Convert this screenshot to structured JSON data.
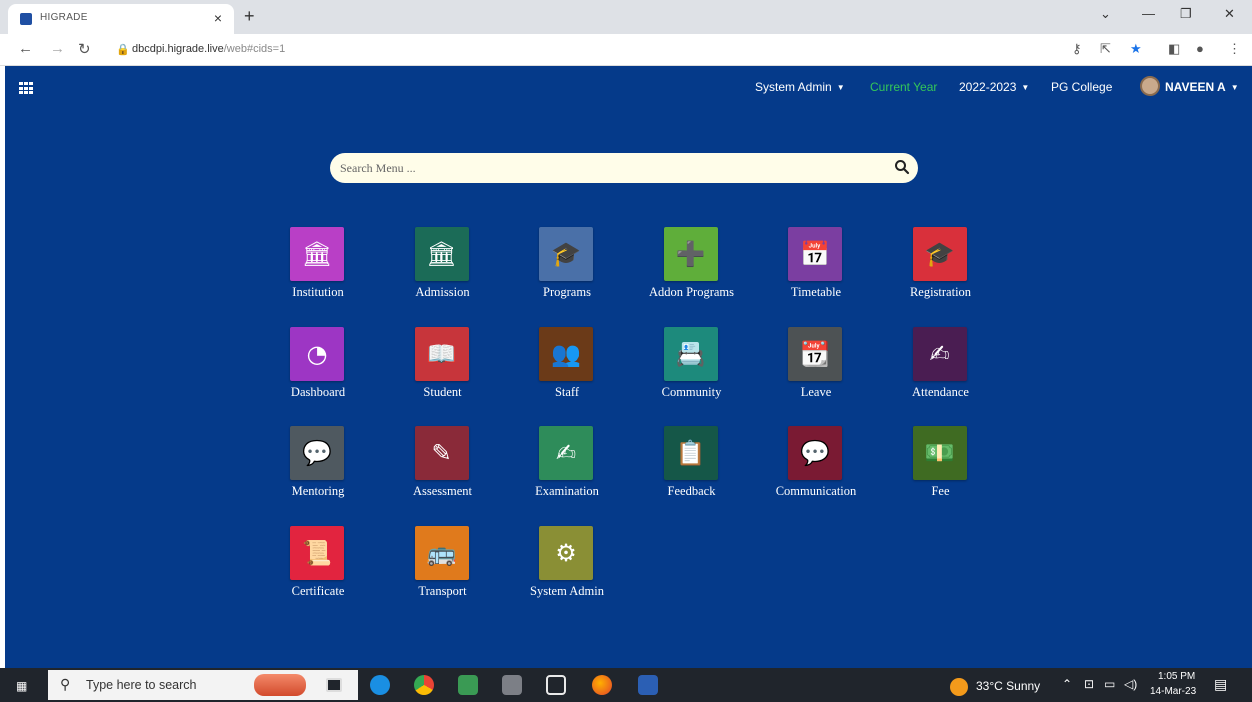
{
  "browser": {
    "tab_title": "HIGRADE",
    "tab_close": "×",
    "new_tab": "+",
    "url_host": "dbcdpi.higrade.live",
    "url_path": "/web#cids=1"
  },
  "topbar": {
    "role": "System Admin",
    "current_year_label": "Current Year",
    "year": "2022-2023",
    "college": "PG College",
    "user": "NAVEEN A"
  },
  "search": {
    "placeholder": "Search Menu ..."
  },
  "apps": [
    {
      "label": "Institution",
      "color": "#b93fc6",
      "icon": "institution-icon",
      "glyph": "🏛"
    },
    {
      "label": "Admission",
      "color": "#1b6b57",
      "icon": "admission-icon",
      "glyph": "🏛"
    },
    {
      "label": "Programs",
      "color": "#4a70a8",
      "icon": "programs-icon",
      "glyph": "🎓"
    },
    {
      "label": "Addon Programs",
      "color": "#5fae3a",
      "icon": "addon-programs-icon",
      "glyph": "➕"
    },
    {
      "label": "Timetable",
      "color": "#7b3ea1",
      "icon": "timetable-icon",
      "glyph": "📅"
    },
    {
      "label": "Registration",
      "color": "#d9303b",
      "icon": "registration-icon",
      "glyph": "🎓"
    },
    {
      "label": "Dashboard",
      "color": "#9d36c4",
      "icon": "dashboard-icon",
      "glyph": "◔"
    },
    {
      "label": "Student",
      "color": "#c7353b",
      "icon": "student-icon",
      "glyph": "📖"
    },
    {
      "label": "Staff",
      "color": "#6b3a18",
      "icon": "staff-icon",
      "glyph": "👥"
    },
    {
      "label": "Community",
      "color": "#1d8a7c",
      "icon": "community-icon",
      "glyph": "📇"
    },
    {
      "label": "Leave",
      "color": "#4d5254",
      "icon": "leave-icon",
      "glyph": "📆"
    },
    {
      "label": "Attendance",
      "color": "#4a1d52",
      "icon": "attendance-icon",
      "glyph": "✍"
    },
    {
      "label": "Mentoring",
      "color": "#4f5960",
      "icon": "mentoring-icon",
      "glyph": "💬"
    },
    {
      "label": "Assessment",
      "color": "#8a2a39",
      "icon": "assessment-icon",
      "glyph": "✎"
    },
    {
      "label": "Examination",
      "color": "#2e8c5a",
      "icon": "examination-icon",
      "glyph": "✍"
    },
    {
      "label": "Feedback",
      "color": "#155748",
      "icon": "feedback-icon",
      "glyph": "📋"
    },
    {
      "label": "Communication",
      "color": "#7a1a33",
      "icon": "communication-icon",
      "glyph": "💬"
    },
    {
      "label": "Fee",
      "color": "#3f6b22",
      "icon": "fee-icon",
      "glyph": "💵"
    },
    {
      "label": "Certificate",
      "color": "#e2243f",
      "icon": "certificate-icon",
      "glyph": "📜"
    },
    {
      "label": "Transport",
      "color": "#e07a1c",
      "icon": "transport-icon",
      "glyph": "🚌"
    },
    {
      "label": "System Admin",
      "color": "#8a8f35",
      "icon": "system-admin-icon",
      "glyph": "⚙"
    }
  ],
  "taskbar": {
    "search_text": "Type here to search",
    "weather": "33°C  Sunny",
    "time": "1:05 PM",
    "date": "14-Mar-23"
  }
}
